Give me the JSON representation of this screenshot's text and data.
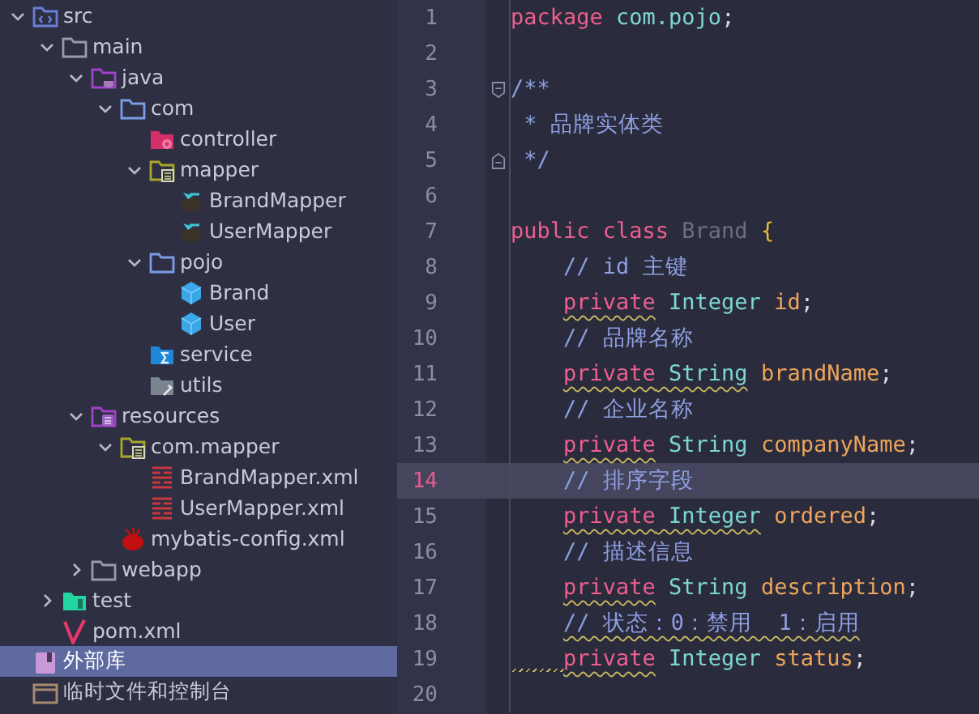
{
  "project_tree": [
    {
      "label": "src",
      "kind": "source-root",
      "expanded": true,
      "selected": false,
      "children": [
        {
          "label": "main",
          "kind": "folder",
          "expanded": true,
          "selected": false,
          "children": [
            {
              "label": "java",
              "kind": "java-root",
              "expanded": true,
              "selected": false,
              "children": [
                {
                  "label": "com",
                  "kind": "package",
                  "expanded": true,
                  "selected": false,
                  "children": [
                    {
                      "label": "controller",
                      "kind": "controller",
                      "selected": false
                    },
                    {
                      "label": "mapper",
                      "kind": "mapper-package",
                      "expanded": true,
                      "selected": false,
                      "children": [
                        {
                          "label": "BrandMapper",
                          "kind": "bird",
                          "selected": false
                        },
                        {
                          "label": "UserMapper",
                          "kind": "bird",
                          "selected": false
                        }
                      ]
                    },
                    {
                      "label": "pojo",
                      "kind": "package",
                      "expanded": true,
                      "selected": false,
                      "children": [
                        {
                          "label": "Brand",
                          "kind": "class",
                          "selected": false
                        },
                        {
                          "label": "User",
                          "kind": "class",
                          "selected": false
                        }
                      ]
                    },
                    {
                      "label": "service",
                      "kind": "service",
                      "selected": false
                    },
                    {
                      "label": "utils",
                      "kind": "utils",
                      "selected": false
                    }
                  ]
                }
              ]
            },
            {
              "label": "resources",
              "kind": "resources",
              "expanded": true,
              "selected": false,
              "children": [
                {
                  "label": "com.mapper",
                  "kind": "mapper-package",
                  "expanded": true,
                  "selected": false,
                  "children": [
                    {
                      "label": "BrandMapper.xml",
                      "kind": "xml",
                      "selected": false
                    },
                    {
                      "label": "UserMapper.xml",
                      "kind": "xml",
                      "selected": false
                    }
                  ]
                },
                {
                  "label": "mybatis-config.xml",
                  "kind": "config",
                  "selected": false
                }
              ]
            },
            {
              "label": "webapp",
              "kind": "folder",
              "expanded": false,
              "selected": false
            }
          ]
        },
        {
          "label": "test",
          "kind": "test",
          "expanded": false,
          "selected": false
        },
        {
          "label": "pom.xml",
          "kind": "maven",
          "selected": false
        }
      ]
    },
    {
      "label": "外部库",
      "kind": "library",
      "selected": true
    },
    {
      "label": "临时文件和控制台",
      "kind": "scratch",
      "selected": false
    }
  ],
  "editor": {
    "lines": [
      {
        "number": "1",
        "kind": "code",
        "current": false,
        "tokens": [
          {
            "text": "package ",
            "kind": "keyword"
          },
          {
            "text": "com.pojo",
            "kind": "type"
          },
          {
            "text": ";",
            "kind": "punct"
          }
        ]
      },
      {
        "number": "2",
        "kind": "code",
        "current": false
      },
      {
        "number": "3",
        "kind": "fold-start",
        "current": false,
        "tokens": [
          {
            "text": "/**",
            "kind": "comment"
          }
        ]
      },
      {
        "number": "4",
        "kind": "code",
        "current": false,
        "tokens": [
          {
            "text": " * 品牌实体类",
            "kind": "comment"
          }
        ]
      },
      {
        "number": "5",
        "kind": "fold-end",
        "current": false,
        "tokens": [
          {
            "text": " */",
            "kind": "comment"
          }
        ]
      },
      {
        "number": "6",
        "kind": "code",
        "current": false
      },
      {
        "number": "7",
        "kind": "code",
        "current": false,
        "tokens": [
          {
            "text": "public class ",
            "kind": "keyword"
          },
          {
            "text": "Brand ",
            "kind": "unused"
          },
          {
            "text": "{",
            "kind": "brace"
          }
        ]
      },
      {
        "number": "8",
        "kind": "code",
        "current": false,
        "indented": true,
        "tokens": [
          {
            "text": "// id 主键",
            "kind": "comment"
          }
        ]
      },
      {
        "number": "9",
        "kind": "code",
        "current": false,
        "indented": true,
        "tokens": [
          {
            "text": "private",
            "kind": "keyword",
            "warn": true
          },
          {
            "text": " Integer ",
            "kind": "type"
          },
          {
            "text": "id",
            "kind": "field"
          },
          {
            "text": ";",
            "kind": "punct"
          }
        ]
      },
      {
        "number": "10",
        "kind": "code",
        "current": false,
        "indented": true,
        "tokens": [
          {
            "text": "// 品牌名称",
            "kind": "comment"
          }
        ]
      },
      {
        "number": "11",
        "kind": "code",
        "current": false,
        "indented": true,
        "tokens": [
          {
            "text": "private",
            "kind": "keyword",
            "warn": true
          },
          {
            "text": " String",
            "kind": "type",
            "warn": true
          },
          {
            "text": " brandName",
            "kind": "field"
          },
          {
            "text": ";",
            "kind": "punct"
          }
        ]
      },
      {
        "number": "12",
        "kind": "code",
        "current": false,
        "indented": true,
        "tokens": [
          {
            "text": "// 企业名称",
            "kind": "comment"
          }
        ]
      },
      {
        "number": "13",
        "kind": "code",
        "current": false,
        "indented": true,
        "tokens": [
          {
            "text": "private",
            "kind": "keyword",
            "warn": true
          },
          {
            "text": " String ",
            "kind": "type"
          },
          {
            "text": "companyName",
            "kind": "field"
          },
          {
            "text": ";",
            "kind": "punct"
          }
        ]
      },
      {
        "number": "14",
        "kind": "code",
        "current": true,
        "indented": true,
        "tokens": [
          {
            "text": "// 排序字段",
            "kind": "comment"
          }
        ]
      },
      {
        "number": "15",
        "kind": "code",
        "current": false,
        "indented": true,
        "tokens": [
          {
            "text": "private",
            "kind": "keyword",
            "warn": true
          },
          {
            "text": " Integer",
            "kind": "type",
            "warn": true
          },
          {
            "text": " ordered",
            "kind": "field"
          },
          {
            "text": ";",
            "kind": "punct"
          }
        ]
      },
      {
        "number": "16",
        "kind": "code",
        "current": false,
        "indented": true,
        "tokens": [
          {
            "text": "// 描述信息",
            "kind": "comment"
          }
        ]
      },
      {
        "number": "17",
        "kind": "code",
        "current": false,
        "indented": true,
        "tokens": [
          {
            "text": "private",
            "kind": "keyword",
            "warn": true
          },
          {
            "text": " String ",
            "kind": "type"
          },
          {
            "text": "description",
            "kind": "field"
          },
          {
            "text": ";",
            "kind": "punct"
          }
        ]
      },
      {
        "number": "18",
        "kind": "code",
        "current": false,
        "indented": true,
        "tokens": [
          {
            "text": "// 状态：0：禁用  1：启用",
            "kind": "comment",
            "warn": true
          }
        ]
      },
      {
        "number": "19",
        "kind": "code",
        "current": false,
        "indented": true,
        "indent_warning": true,
        "tokens": [
          {
            "text": "private",
            "kind": "keyword",
            "warn": true
          },
          {
            "text": " Integer ",
            "kind": "type"
          },
          {
            "text": "status",
            "kind": "field"
          },
          {
            "text": ";",
            "kind": "punct"
          }
        ]
      },
      {
        "number": "20",
        "kind": "code",
        "current": false
      }
    ]
  }
}
